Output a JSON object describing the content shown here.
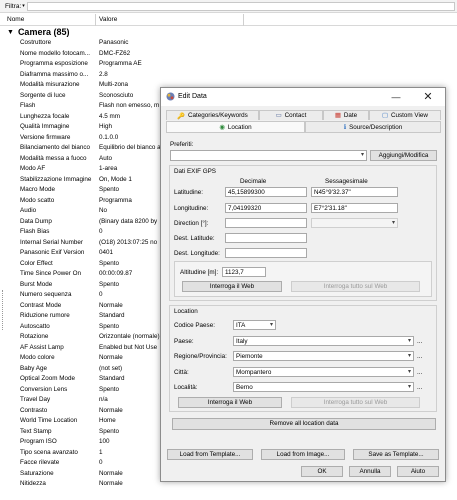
{
  "filter": {
    "label": "Filtra:"
  },
  "columns": {
    "name": "Nome",
    "value": "Valore"
  },
  "category": {
    "title": "Camera (85)"
  },
  "rows": [
    {
      "k": "Costruttore",
      "v": "Panasonic"
    },
    {
      "k": "Nome modello fotocam...",
      "v": "DMC-FZ62"
    },
    {
      "k": "Programma esposizione",
      "v": "Programma AE"
    },
    {
      "k": "Diaframma massimo o...",
      "v": "2.8"
    },
    {
      "k": "Modalità misurazione",
      "v": "Multi-zona"
    },
    {
      "k": "Sorgente di luce",
      "v": "Sconosciuto"
    },
    {
      "k": "Flash",
      "v": "Flash non emesso, m"
    },
    {
      "k": "Lunghezza focale",
      "v": "4.5 mm"
    },
    {
      "k": "Qualità Immagine",
      "v": "High"
    },
    {
      "k": "Versione firmware",
      "v": "0.1.0.0"
    },
    {
      "k": "Bilanciamento del bianco",
      "v": "Equilibrio del bianco a"
    },
    {
      "k": "Modalità messa a fuoco",
      "v": "Auto"
    },
    {
      "k": "Modo AF",
      "v": "1-area"
    },
    {
      "k": "Stabilizzazione Immagine",
      "v": "On, Mode 1"
    },
    {
      "k": "Macro Mode",
      "v": "Spento"
    },
    {
      "k": "Modo scatto",
      "v": "Programma"
    },
    {
      "k": "Audio",
      "v": "No"
    },
    {
      "k": "Data Dump",
      "v": "(Binary data 8200 by"
    },
    {
      "k": "Flash Bias",
      "v": "0"
    },
    {
      "k": "Internal Serial Number",
      "v": "(O18) 2013:07:25 no"
    },
    {
      "k": "Panasonic Exif Version",
      "v": "0401"
    },
    {
      "k": "Color Effect",
      "v": "Spento"
    },
    {
      "k": "Time Since Power On",
      "v": "00:00:09.87"
    },
    {
      "k": "Burst Mode",
      "v": "Spento"
    },
    {
      "k": "Numero sequenza",
      "v": "0"
    },
    {
      "k": "Contrast Mode",
      "v": "Normale"
    },
    {
      "k": "Riduzione rumore",
      "v": "Standard"
    },
    {
      "k": "Autoscatto",
      "v": "Spento"
    },
    {
      "k": "Rotazione",
      "v": "Orizzontale (normale)"
    },
    {
      "k": "AF Assist Lamp",
      "v": "Enabled but Not Use"
    },
    {
      "k": "Modo colore",
      "v": "Normale"
    },
    {
      "k": "Baby Age",
      "v": "(not set)"
    },
    {
      "k": "Optical Zoom Mode",
      "v": "Standard"
    },
    {
      "k": "Conversion Lens",
      "v": "Spento"
    },
    {
      "k": "Travel Day",
      "v": "n/a"
    },
    {
      "k": "Contrasto",
      "v": "Normale"
    },
    {
      "k": "World Time Location",
      "v": "Home"
    },
    {
      "k": "Text Stamp",
      "v": "Spento"
    },
    {
      "k": "Program ISO",
      "v": "100"
    },
    {
      "k": "Tipo scena avanzato",
      "v": "1"
    },
    {
      "k": "Facce rilevate",
      "v": "0"
    },
    {
      "k": "Saturazione",
      "v": "Normale"
    },
    {
      "k": "Nitidezza",
      "v": "Normale"
    }
  ],
  "dialog": {
    "title": "Edit Data",
    "tabs": {
      "categories": "Categories/Keywords",
      "contact": "Contact",
      "date": "Date",
      "custom": "Custom View",
      "location": "Location",
      "source": "Source/Description"
    },
    "preferiti": {
      "label": "Preferiti:",
      "add_button": "Aggiungi/Modifica"
    },
    "gps": {
      "group_title": "Dati EXIF GPS",
      "col_decimal": "Decimale",
      "col_sexagesimal": "Sessagesimale",
      "latitude_label": "Latitudine:",
      "latitude_decimal": "45,15899300",
      "latitude_sexagesimal": "N45°9'32.37\"",
      "longitude_label": "Longitudine:",
      "longitude_decimal": "7,04199320",
      "longitude_sexagesimal": "E7°2'31.18\"",
      "direction_label": "Direction [°]:",
      "dest_lat_label": "Dest. Latitude:",
      "dest_lon_label": "Dest. Longitude:",
      "altitude_label": "Altitudine [m]:",
      "altitude_value": "1123,7",
      "query_web": "Interroga il Web",
      "query_all_web": "Interroga tutto sul Web"
    },
    "location": {
      "group_title": "Location",
      "country_code_label": "Codice Paese:",
      "country_code": "ITA",
      "country_label": "Paese:",
      "country": "Italy",
      "region_label": "Regione/Provincia:",
      "region": "Piemonte",
      "city_label": "Città:",
      "city": "Mompantero",
      "locality_label": "Località:",
      "locality": "Berno",
      "query_web": "Interroga il Web",
      "query_all_web": "Interroga tutto sul Web",
      "remove_all": "Remove all location data"
    },
    "bottom": {
      "load_template": "Load from Template...",
      "load_image": "Load from Image...",
      "save_template": "Save as Template...",
      "ok": "OK",
      "cancel": "Annulla",
      "help": "Aiuto"
    }
  }
}
